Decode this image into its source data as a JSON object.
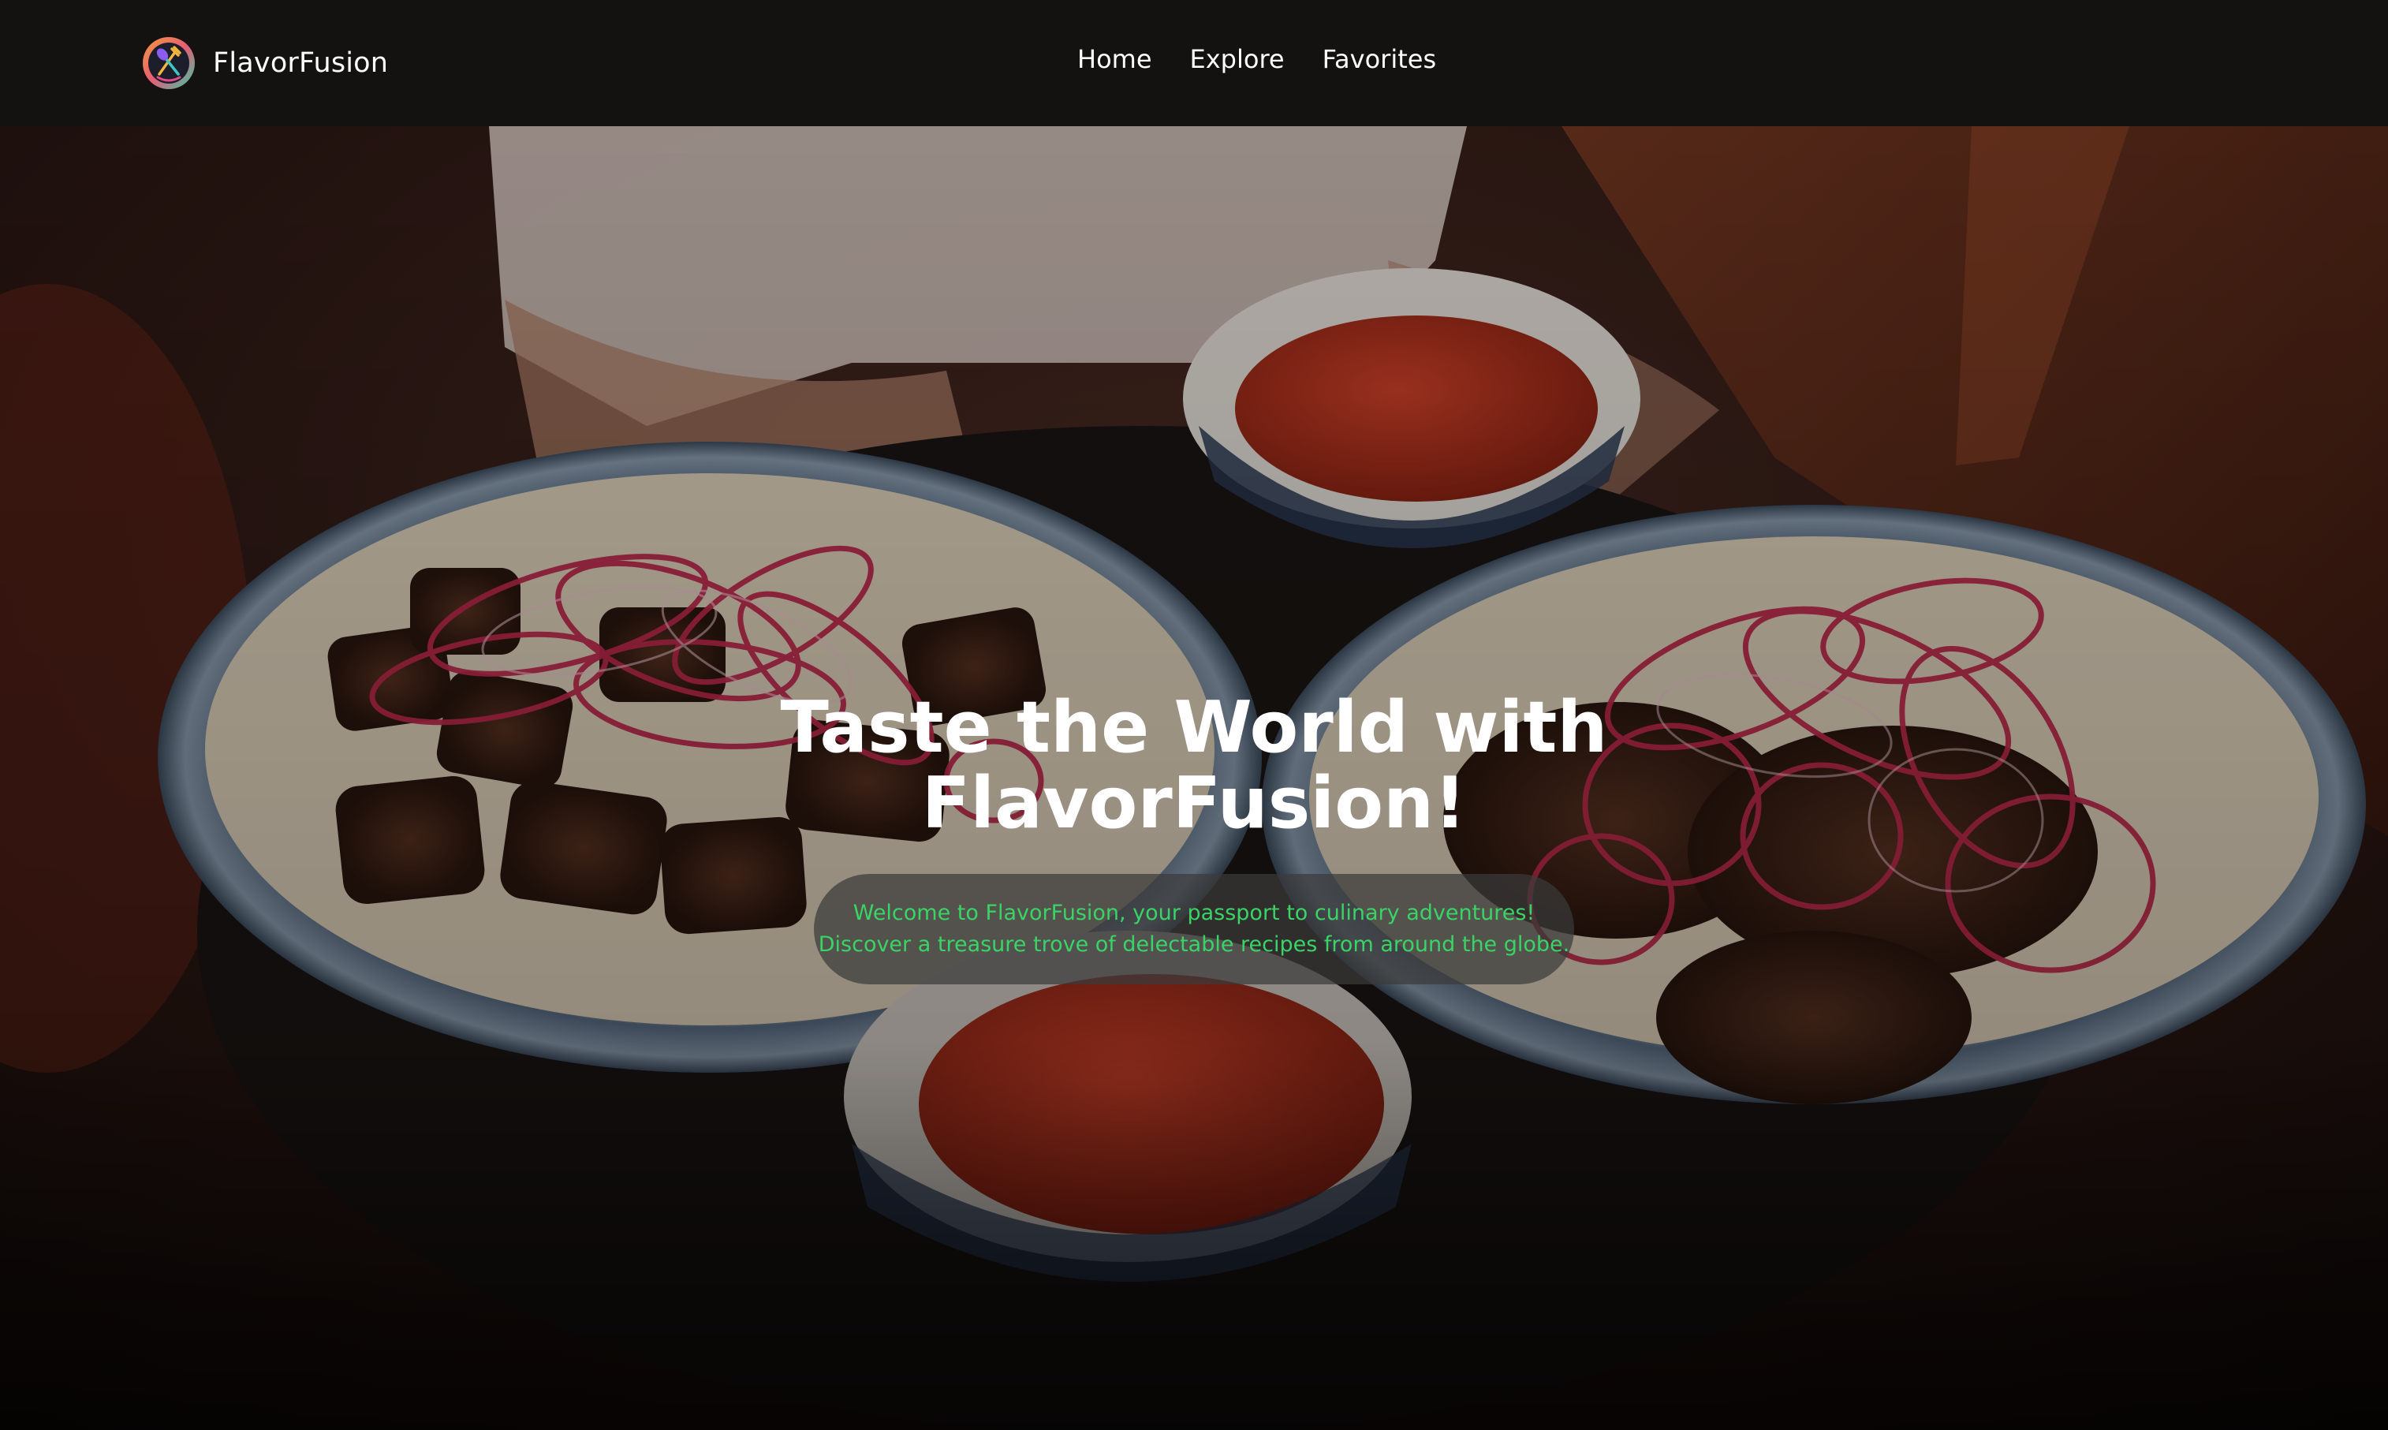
{
  "navbar": {
    "brand_name": "FlavorFusion",
    "logo_icon": "fork-and-spoon-icon",
    "links": [
      {
        "label": "Home"
      },
      {
        "label": "Explore"
      },
      {
        "label": "Favorites"
      }
    ]
  },
  "hero": {
    "title_line1": "Taste the World with",
    "title_line2": "FlavorFusion!",
    "tagline_line1": "Welcome to FlavorFusion, your passport to culinary adventures!",
    "tagline_line2": "Discover a treasure trove of delectable recipes from around the globe."
  },
  "colors": {
    "navbar_bg": "#141211",
    "tagline_text": "#3ad466",
    "tagline_bg": "#3a3a3a",
    "title_text": "#ffffff"
  }
}
